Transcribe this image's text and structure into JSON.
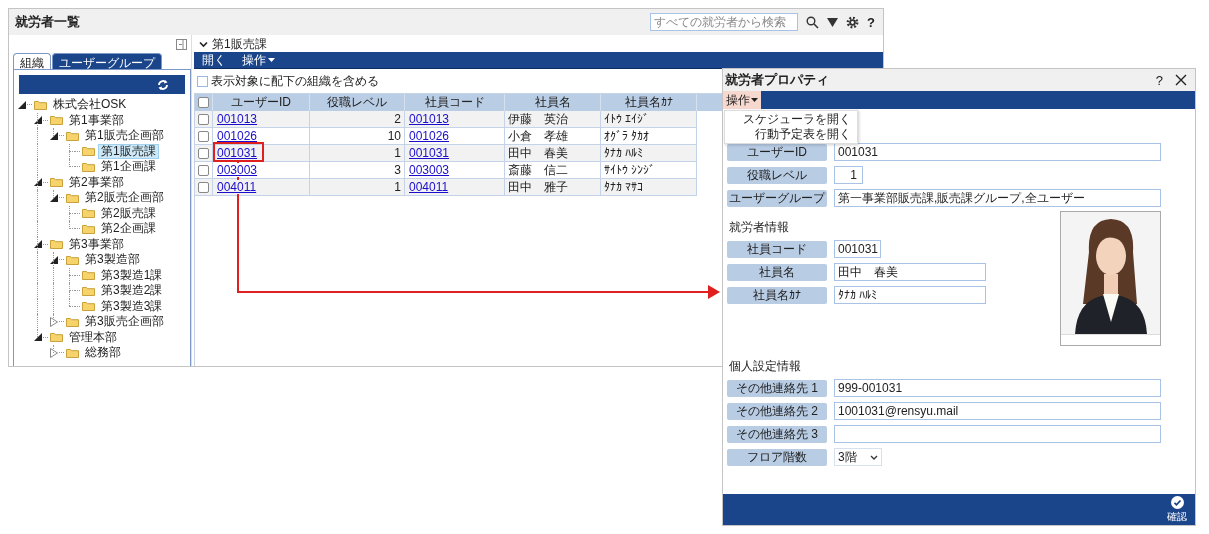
{
  "main_window": {
    "title": "就労者一覧",
    "search": {
      "placeholder": "すべての就労者から検索"
    },
    "help": "?"
  },
  "sidebar": {
    "tabs": [
      {
        "label": "組織",
        "selected": true
      },
      {
        "label": "ユーザーグループ",
        "selected": false
      }
    ],
    "tree": [
      {
        "label": "株式会社OSK",
        "expanded": true,
        "selected": false,
        "children": [
          {
            "label": "第1事業部",
            "expanded": true,
            "selected": false,
            "children": [
              {
                "label": "第1販売企画部",
                "expanded": true,
                "selected": false,
                "children": [
                  {
                    "label": "第1販売課",
                    "selected": true
                  },
                  {
                    "label": "第1企画課",
                    "selected": false
                  }
                ]
              }
            ]
          },
          {
            "label": "第2事業部",
            "expanded": true,
            "selected": false,
            "children": [
              {
                "label": "第2販売企画部",
                "expanded": true,
                "selected": false,
                "children": [
                  {
                    "label": "第2販売課",
                    "selected": false
                  },
                  {
                    "label": "第2企画課",
                    "selected": false
                  }
                ]
              }
            ]
          },
          {
            "label": "第3事業部",
            "expanded": true,
            "selected": false,
            "children": [
              {
                "label": "第3製造部",
                "expanded": true,
                "selected": false,
                "children": [
                  {
                    "label": "第3製造1課",
                    "selected": false
                  },
                  {
                    "label": "第3製造2課",
                    "selected": false
                  },
                  {
                    "label": "第3製造3課",
                    "selected": false
                  }
                ]
              },
              {
                "label": "第3販売企画部",
                "expanded": false,
                "selected": false
              }
            ]
          },
          {
            "label": "管理本部",
            "expanded": true,
            "selected": false,
            "children": [
              {
                "label": "総務部",
                "expanded": false,
                "selected": false
              }
            ]
          }
        ]
      }
    ]
  },
  "list": {
    "header": "第1販売課",
    "toolbar": [
      {
        "label": "開く",
        "menu": false
      },
      {
        "label": "操作",
        "menu": true
      }
    ],
    "include_sub": {
      "label": "表示対象に配下の組織を含める",
      "checked": false
    },
    "header_checked": false,
    "columns": [
      "ユーザーID",
      "役職レベル",
      "社員コード",
      "社員名",
      "社員名ｶﾅ"
    ],
    "rows": [
      {
        "checked": false,
        "user_id": "001013",
        "position_level": "2",
        "code": "001013",
        "name": "伊藤　英治",
        "kana": "ｲﾄｳ ｴｲｼﾞ"
      },
      {
        "checked": false,
        "user_id": "001026",
        "position_level": "10",
        "code": "001026",
        "name": "小倉　孝雄",
        "kana": "ｵｸﾞﾗ ﾀｶｵ"
      },
      {
        "checked": false,
        "user_id": "001031",
        "position_level": "1",
        "code": "001031",
        "name": "田中　春美",
        "kana": "ﾀﾅｶ ﾊﾙﾐ"
      },
      {
        "checked": false,
        "user_id": "003003",
        "position_level": "3",
        "code": "003003",
        "name": "斎藤　信二",
        "kana": "ｻｲﾄｳ ｼﾝｼﾞ"
      },
      {
        "checked": false,
        "user_id": "004011",
        "position_level": "1",
        "code": "004011",
        "name": "田中　雅子",
        "kana": "ﾀﾅｶ ﾏｻｺ"
      }
    ]
  },
  "dialog": {
    "title": "就労者プロパティ",
    "help": "?",
    "menu_button": {
      "label": "操作",
      "open": true
    },
    "menu_items": [
      "スケジューラを開く",
      "行動予定表を開く"
    ],
    "sections": [
      {
        "fields": [
          {
            "label": "ユーザーID",
            "value": "001031",
            "kind": "wide"
          },
          {
            "label": "役職レベル",
            "value": "1",
            "kind": "number"
          },
          {
            "label": "ユーザーグループ",
            "value": "第一事業部販売課,販売課グループ,全ユーザー",
            "kind": "wide"
          }
        ]
      },
      {
        "heading": "就労者情報",
        "photo": {
          "kind": "picture"
        },
        "fields": [
          {
            "label": "社員コード",
            "value": "001031",
            "kind": "short"
          },
          {
            "label": "社員名",
            "value": "田中　春美",
            "kind": "medium"
          },
          {
            "label": "社員名ｶﾅ",
            "value": "ﾀﾅｶ ﾊﾙﾐ",
            "kind": "medium"
          }
        ]
      },
      {
        "heading": "個人設定情報",
        "fields": [
          {
            "label": "その他連絡先 1",
            "value": "999-001031",
            "kind": "wide"
          },
          {
            "label": "その他連絡先 2",
            "value": "1001031@rensyu.mail",
            "kind": "wide"
          },
          {
            "label": "その他連絡先 3",
            "kind": "wide"
          },
          {
            "label": "フロア階数",
            "value": "3階",
            "kind": "select"
          }
        ]
      }
    ],
    "footer": {
      "confirm": "確認"
    }
  }
}
